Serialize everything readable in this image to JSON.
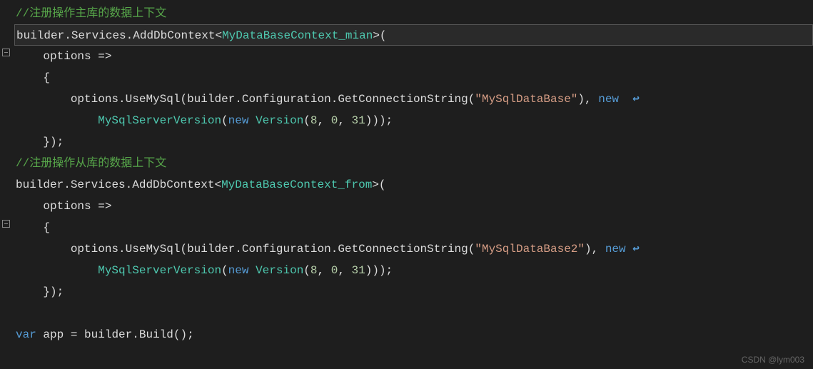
{
  "code": {
    "comment1": "//注册操作主库的数据上下文",
    "line2": {
      "builder": "builder",
      "dot1": ".",
      "services": "Services",
      "dot2": ".",
      "addDbContext": "AddDbContext",
      "lt": "<",
      "type1": "MyDataBaseContext_mian",
      "gt": ">",
      "open": "("
    },
    "line3": {
      "indent": "    ",
      "options": "options",
      "arrow": " =>"
    },
    "line4": {
      "indent": "    ",
      "brace": "{"
    },
    "line5": {
      "indent": "        ",
      "options": "options",
      "dot": ".",
      "useMySql": "UseMySql",
      "open": "(",
      "builder": "builder",
      "dot2": ".",
      "config": "Configuration",
      "dot3": ".",
      "getConn": "GetConnectionString",
      "open2": "(",
      "str": "\"MySqlDataBase\"",
      "close2": ")",
      "comma": ", ",
      "new": "new",
      "space": "  "
    },
    "line6": {
      "indent": "            ",
      "mysqlVer": "MySqlServerVersion",
      "open": "(",
      "new": "new",
      "space": " ",
      "version": "Version",
      "open2": "(",
      "n1": "8",
      "c1": ", ",
      "n2": "0",
      "c2": ", ",
      "n3": "31",
      "close": ")));"
    },
    "line7": {
      "indent": "    ",
      "close": "});"
    },
    "comment2": "//注册操作从库的数据上下文",
    "line9": {
      "builder": "builder",
      "dot1": ".",
      "services": "Services",
      "dot2": ".",
      "addDbContext": "AddDbContext",
      "lt": "<",
      "type2": "MyDataBaseContext_from",
      "gt": ">",
      "open": "("
    },
    "line10": {
      "indent": "    ",
      "options": "options",
      "arrow": " =>"
    },
    "line11": {
      "indent": "    ",
      "brace": "{"
    },
    "line12": {
      "indent": "        ",
      "options": "options",
      "dot": ".",
      "useMySql": "UseMySql",
      "open": "(",
      "builder": "builder",
      "dot2": ".",
      "config": "Configuration",
      "dot3": ".",
      "getConn": "GetConnectionString",
      "open2": "(",
      "str": "\"MySqlDataBase2\"",
      "close2": ")",
      "comma": ", ",
      "new": "new",
      "space": " "
    },
    "line13": {
      "indent": "            ",
      "mysqlVer": "MySqlServerVersion",
      "open": "(",
      "new": "new",
      "space": " ",
      "version": "Version",
      "open2": "(",
      "n1": "8",
      "c1": ", ",
      "n2": "0",
      "c2": ", ",
      "n3": "31",
      "close": ")));"
    },
    "line14": {
      "indent": "    ",
      "close": "});"
    },
    "line16": {
      "var": "var",
      "space": " ",
      "app": "app",
      "eq": " = ",
      "builder": "builder",
      "dot": ".",
      "build": "Build",
      "parens": "();"
    }
  },
  "watermark": "CSDN @lym003",
  "wrapIcon": "↩"
}
